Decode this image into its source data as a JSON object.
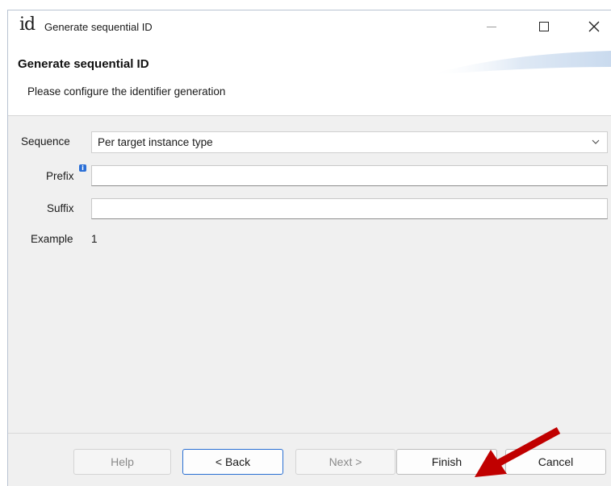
{
  "window": {
    "app_icon_text": "id",
    "title": "Generate sequential ID"
  },
  "header": {
    "title": "Generate sequential ID",
    "description": "Please configure the identifier generation"
  },
  "form": {
    "sequence_label": "Sequence",
    "sequence_value": "Per target instance type",
    "prefix_label": "Prefix",
    "prefix_value": "",
    "suffix_label": "Suffix",
    "suffix_value": "",
    "example_label": "Example",
    "example_value": "1"
  },
  "buttons": {
    "help": "Help",
    "back": "< Back",
    "next": "Next >",
    "finish": "Finish",
    "cancel": "Cancel"
  },
  "colors": {
    "annotation_arrow": "#c00000",
    "primary_border": "#2a6fd3",
    "info_icon": "#2b6fd6"
  }
}
